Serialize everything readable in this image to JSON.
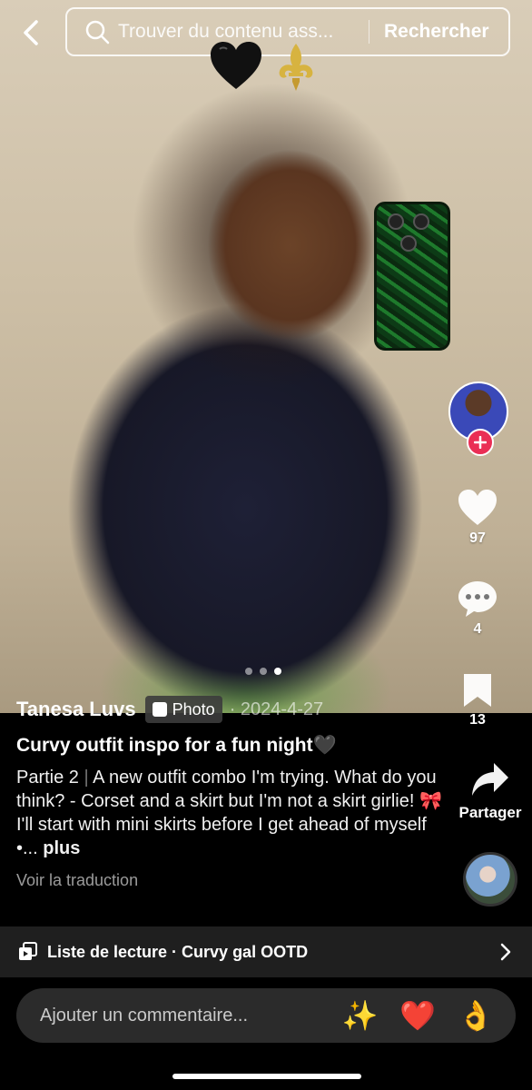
{
  "header": {
    "back_icon": "chevron-left-icon",
    "search_placeholder": "Trouver du contenu ass...",
    "search_button": "Rechercher"
  },
  "overlay_emojis": [
    "🖤",
    "⚜️"
  ],
  "post": {
    "author": "Tanesa Luvs",
    "badge": "Photo",
    "date": "2024-4-27",
    "title": "Curvy outfit inspo for a fun night🖤",
    "part": "Partie 2",
    "description": "A new outfit combo I'm trying. What do you think? - Corset and a skirt but I'm not a skirt girlie! 🎀 I'll start with mini skirts before I get ahead of myself •...",
    "more": "plus",
    "translate": "Voir la traduction",
    "carousel_total": 3,
    "carousel_active": 3
  },
  "rail": {
    "likes": "97",
    "comments": "4",
    "saves": "13",
    "share_label": "Partager"
  },
  "playlist": {
    "label": "Liste de lecture · Curvy gal OOTD"
  },
  "comment": {
    "placeholder": "Ajouter un commentaire...",
    "quick_emojis": [
      "✨",
      "❤️",
      "👌"
    ]
  },
  "colors": {
    "follow_red": "#ea2e55",
    "background": "#000000"
  }
}
